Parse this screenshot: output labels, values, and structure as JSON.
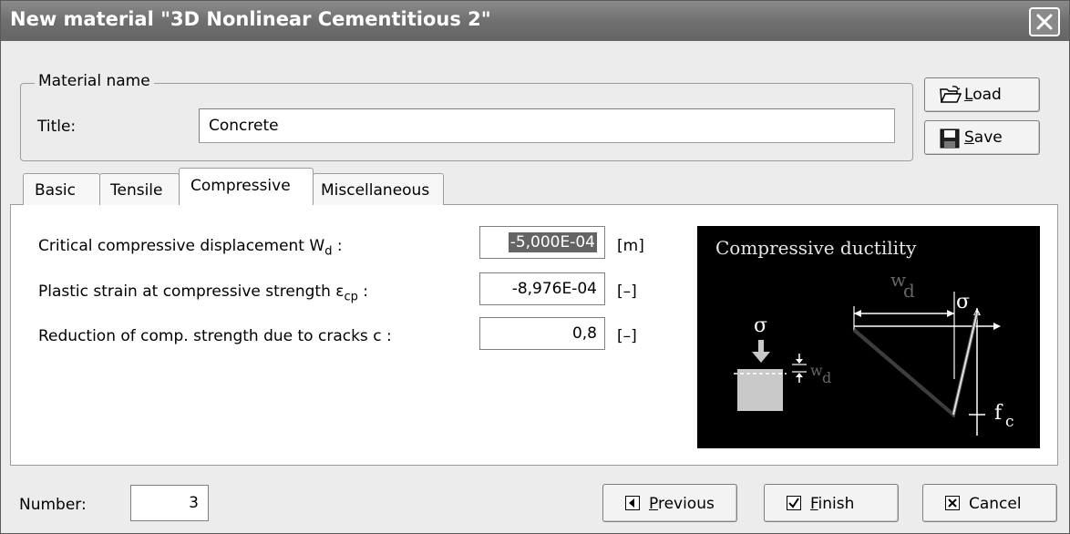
{
  "window": {
    "title": "New material \"3D Nonlinear Cementitious 2\""
  },
  "material_name": {
    "legend": "Material name",
    "title_label": "Title:",
    "title_value": "Concrete"
  },
  "side_buttons": {
    "load": {
      "underline": "L",
      "rest": "oad",
      "icon": "folder-open-icon"
    },
    "save": {
      "underline": "S",
      "rest": "ave",
      "icon": "floppy-disk-icon"
    }
  },
  "tabs": [
    {
      "label": "Basic",
      "active": false
    },
    {
      "label": "Tensile",
      "active": false
    },
    {
      "label": "Compressive",
      "active": true
    },
    {
      "label": "Miscellaneous",
      "active": false
    }
  ],
  "properties": [
    {
      "label": "Critical compressive displacement W",
      "sub": "d",
      "suffix": " :",
      "value": "-5,000E-04",
      "unit": "[m]",
      "selected": true
    },
    {
      "label": "Plastic strain at compressive strength ε",
      "sub": "cp",
      "suffix": " :",
      "value": "-8,976E-04",
      "unit": "[–]",
      "selected": false
    },
    {
      "label": "Reduction of comp. strength due to cracks  c :",
      "sub": "",
      "suffix": "",
      "value": "0,8",
      "unit": "[–]",
      "selected": false
    }
  ],
  "figure": {
    "caption": "Compressive ductility",
    "labels": {
      "w": "w",
      "d": "d",
      "sigma": "σ",
      "f": "f",
      "c": "c"
    }
  },
  "footer": {
    "number_label": "Number:",
    "number_value": "3",
    "previous": {
      "underline": "P",
      "rest": "revious",
      "icon": "arrow-left-icon"
    },
    "finish": {
      "underline": "F",
      "rest": "inish",
      "icon": "check-icon"
    },
    "cancel": {
      "label": "Cancel",
      "icon": "close-x-icon"
    }
  }
}
